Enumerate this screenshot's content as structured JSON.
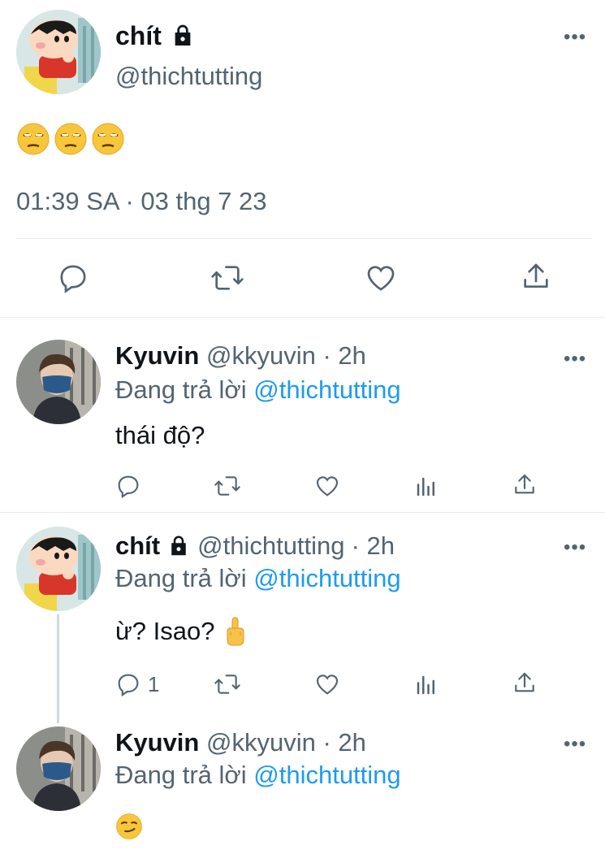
{
  "main_tweet": {
    "display_name": "chít",
    "handle": "@thichtutting",
    "text_emoji_count": 3,
    "timestamp": "01:39 SA · 03 thg 7 23",
    "protected_icon": "lock-icon",
    "actions": [
      "reply-icon",
      "retweet-icon",
      "like-icon",
      "share-icon"
    ]
  },
  "replies": [
    {
      "display_name": "Kyuvin",
      "handle": "@kkyuvin",
      "time": "· 2h",
      "replying_prefix": "Đang trả lời",
      "replying_to": "@thichtutting",
      "text": "thái độ?",
      "reply_count": ""
    },
    {
      "display_name": "chít",
      "handle": "@thichtutting",
      "time": "· 2h",
      "replying_prefix": "Đang trả lời",
      "replying_to": "@thichtutting",
      "text": "ừ? Isao?",
      "reply_count": "1"
    },
    {
      "display_name": "Kyuvin",
      "handle": "@kkyuvin",
      "time": "· 2h",
      "replying_prefix": "Đang trả lời",
      "replying_to": "@thichtutting",
      "text": "",
      "reply_count": ""
    }
  ],
  "colors": {
    "text": "#0f1419",
    "muted": "#536471",
    "link": "#1d9bf0",
    "divider": "#e6ecf0",
    "thread_line": "#cfd9de"
  }
}
